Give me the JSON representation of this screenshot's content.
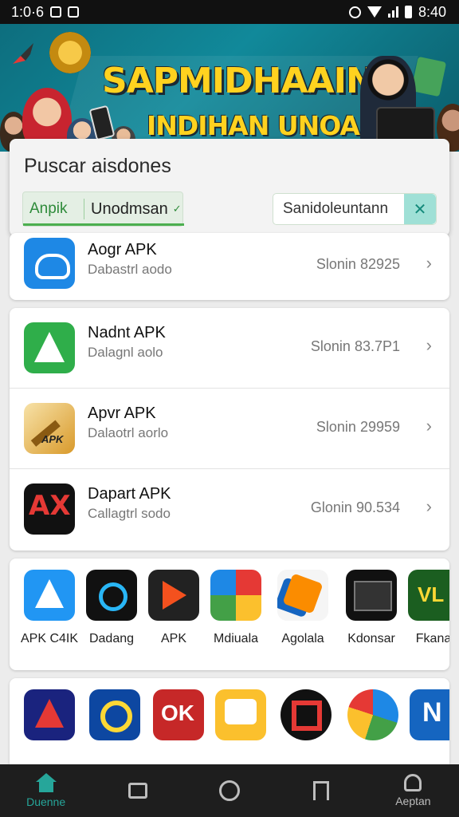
{
  "status_bar": {
    "left_text": "1:0·6",
    "time": "8:40"
  },
  "banner": {
    "title": "SAPMIDHAAIN",
    "subtitle": "INDIHAN UNOAIIN"
  },
  "search_sheet": {
    "title": "Puscar aisdones",
    "filter_left": "Anpik",
    "filter_right": "Unodmsan",
    "search_value": "Sanidolеuntann",
    "accent_color": "#4caf50"
  },
  "list_rows": [
    {
      "title": "Aogr APK",
      "subtitle": "Dabastrl aodo",
      "version": "Slonin 82925",
      "icon": "cloud-icon"
    },
    {
      "title": "Nadnt APK",
      "subtitle": "Dalagnl aolo",
      "version": "Slonin 83.7P1",
      "icon": "app-store-icon"
    },
    {
      "title": "Apvr APK",
      "subtitle": "Dalaotrl aorlo",
      "version": "Slonin 29959",
      "icon": "apk-gold-icon"
    },
    {
      "title": "Dapart APK",
      "subtitle": "Callagtrl sodo",
      "version": "Glonin 90.534",
      "icon": "ax-icon"
    }
  ],
  "grid_row_1": [
    {
      "label": "APK C4IK",
      "icon": "app-store-icon"
    },
    {
      "label": "Dadang",
      "icon": "ring-icon"
    },
    {
      "label": "APK",
      "icon": "play-icon"
    },
    {
      "label": "Mdiuala",
      "icon": "maps-icon"
    },
    {
      "label": "Agolala",
      "icon": "box-icon"
    },
    {
      "label": "Kdonsar",
      "icon": "terminal-icon"
    },
    {
      "label": "Fkana",
      "icon": "vl-icon"
    }
  ],
  "grid_row_2": [
    {
      "label": "",
      "icon": "app-store-red-icon"
    },
    {
      "label": "",
      "icon": "coin-icon"
    },
    {
      "label": "",
      "icon": "ok-icon"
    },
    {
      "label": "",
      "icon": "chat-bubble-icon"
    },
    {
      "label": "",
      "icon": "square-target-icon"
    },
    {
      "label": "",
      "icon": "chrome-icon"
    },
    {
      "label": "",
      "icon": "n-icon"
    }
  ],
  "bottom_nav": [
    {
      "label": "Duenne",
      "icon": "home-icon",
      "active": true
    },
    {
      "label": "",
      "icon": "chat-icon",
      "active": false
    },
    {
      "label": "",
      "icon": "circle-icon",
      "active": false
    },
    {
      "label": "",
      "icon": "bookmark-icon",
      "active": false
    },
    {
      "label": "Aeptan",
      "icon": "person-icon",
      "active": false
    }
  ]
}
